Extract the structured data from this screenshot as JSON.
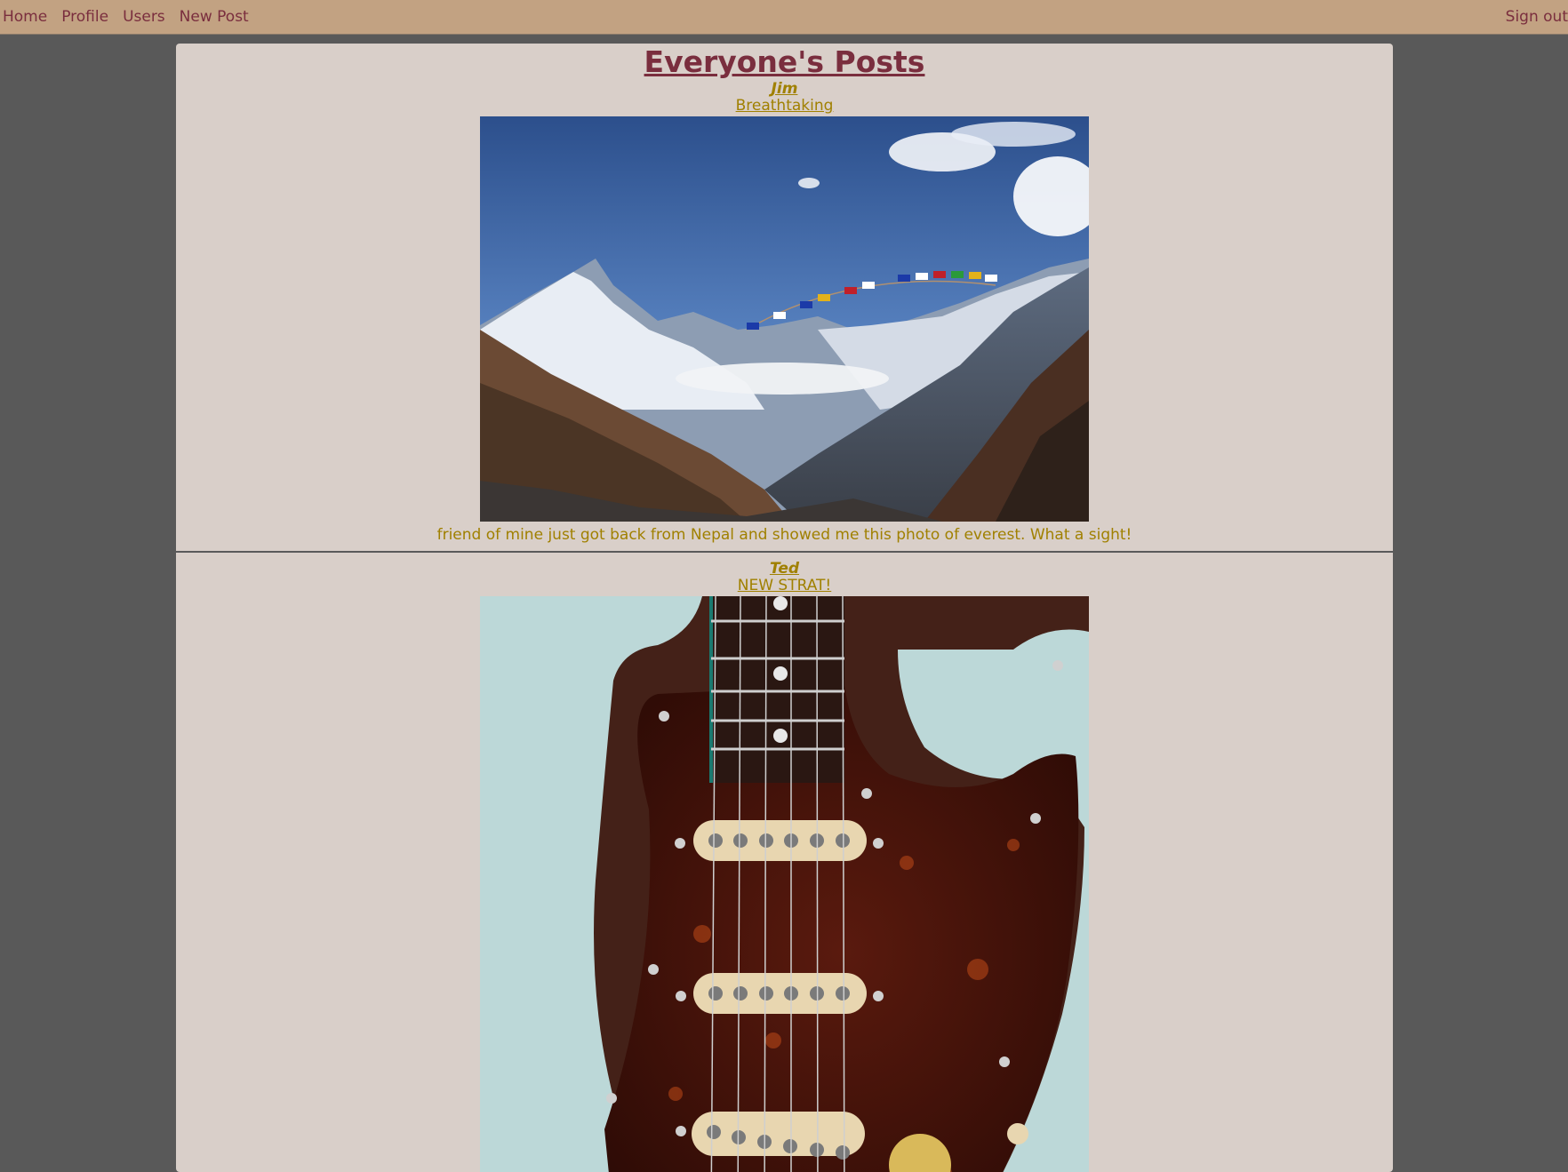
{
  "nav": {
    "home": "Home",
    "profile": "Profile",
    "users": "Users",
    "new_post": "New Post",
    "sign_out": "Sign out"
  },
  "page_title": "Everyone's Posts",
  "posts": [
    {
      "author": "Jim",
      "title": "Breathtaking",
      "image": "mountain-landscape-photo",
      "caption": "friend of mine just got back from Nepal and showed me this photo of everest. What a sight!"
    },
    {
      "author": "Ted",
      "title": "NEW STRAT!",
      "image": "electric-guitar-photo",
      "caption": ""
    }
  ],
  "colors": {
    "navbar_bg": "#c2a282",
    "page_bg": "#595959",
    "feed_bg": "#d9cfc9",
    "title": "#7a2e3e",
    "post_text": "#a08000"
  }
}
